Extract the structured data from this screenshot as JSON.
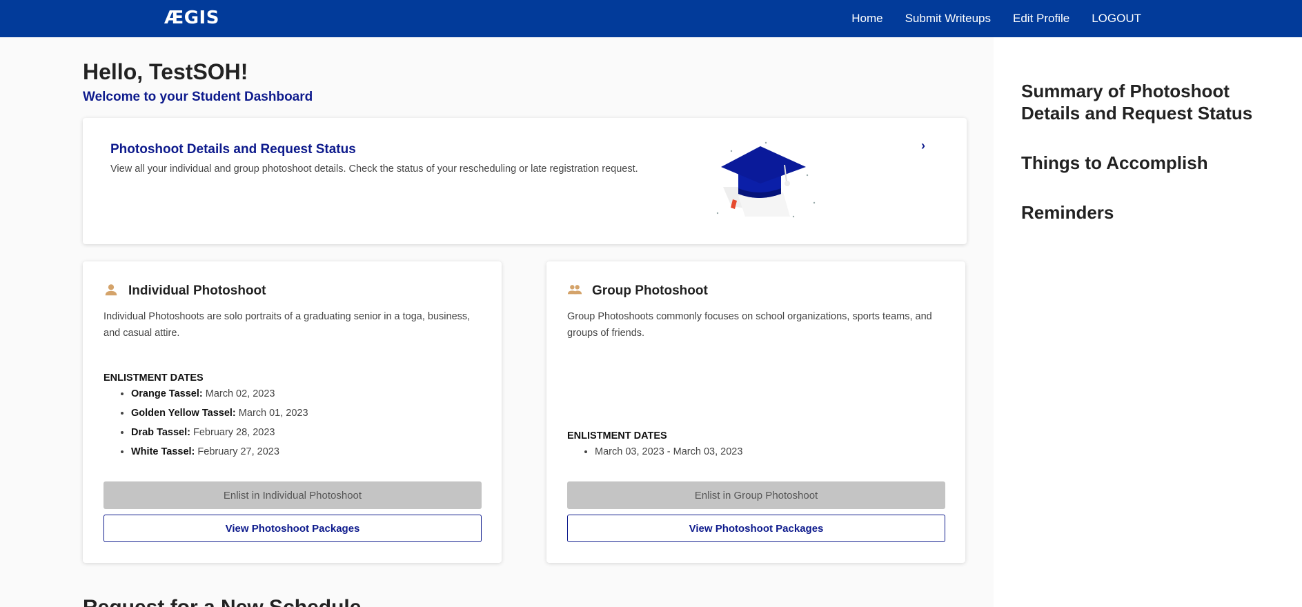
{
  "navbar": {
    "logo": "ÆGIS",
    "links": [
      "Home",
      "Submit Writeups",
      "Edit Profile",
      "LOGOUT"
    ]
  },
  "header": {
    "greeting": "Hello, TestSOH!",
    "welcome": "Welcome to your Student Dashboard"
  },
  "status_card": {
    "title": "Photoshoot Details and Request Status",
    "description": "View all your individual and group photoshoot details. Check the status of your rescheduling or late registration request.",
    "chevron_icon": "chevron-right-icon",
    "illustration": "graduation-cap-icon"
  },
  "individual": {
    "icon": "person-icon",
    "title": "Individual Photoshoot",
    "description": "Individual Photoshoots are solo portraits of a graduating senior in a toga, business, and casual attire.",
    "dates_heading": "ENLISTMENT DATES",
    "dates": [
      {
        "label": "Orange Tassel:",
        "date": "March 02, 2023"
      },
      {
        "label": "Golden Yellow Tassel:",
        "date": "March 01, 2023"
      },
      {
        "label": "Drab Tassel:",
        "date": "February 28, 2023"
      },
      {
        "label": "White Tassel:",
        "date": "February 27, 2023"
      }
    ],
    "enlist_label": "Enlist in Individual Photoshoot",
    "packages_label": "View Photoshoot Packages"
  },
  "group": {
    "icon": "group-icon",
    "title": "Group Photoshoot",
    "description": "Group Photoshoots commonly focuses on school organizations, sports teams, and groups of friends.",
    "dates_heading": "ENLISTMENT DATES",
    "dates": [
      "March 03, 2023 - March 03, 2023"
    ],
    "enlist_label": "Enlist in Group Photoshoot",
    "packages_label": "View Photoshoot Packages"
  },
  "cut_heading": "Request for a New Schedule",
  "sidebar": {
    "links": [
      "Summary of Photoshoot Details and Request Status",
      "Things to Accomplish",
      "Reminders"
    ]
  },
  "colors": {
    "navbar": "#023b9a",
    "accent": "#0d1a8c",
    "icon_tan": "#d4a36a",
    "disabled_button": "#c4c4c4"
  }
}
